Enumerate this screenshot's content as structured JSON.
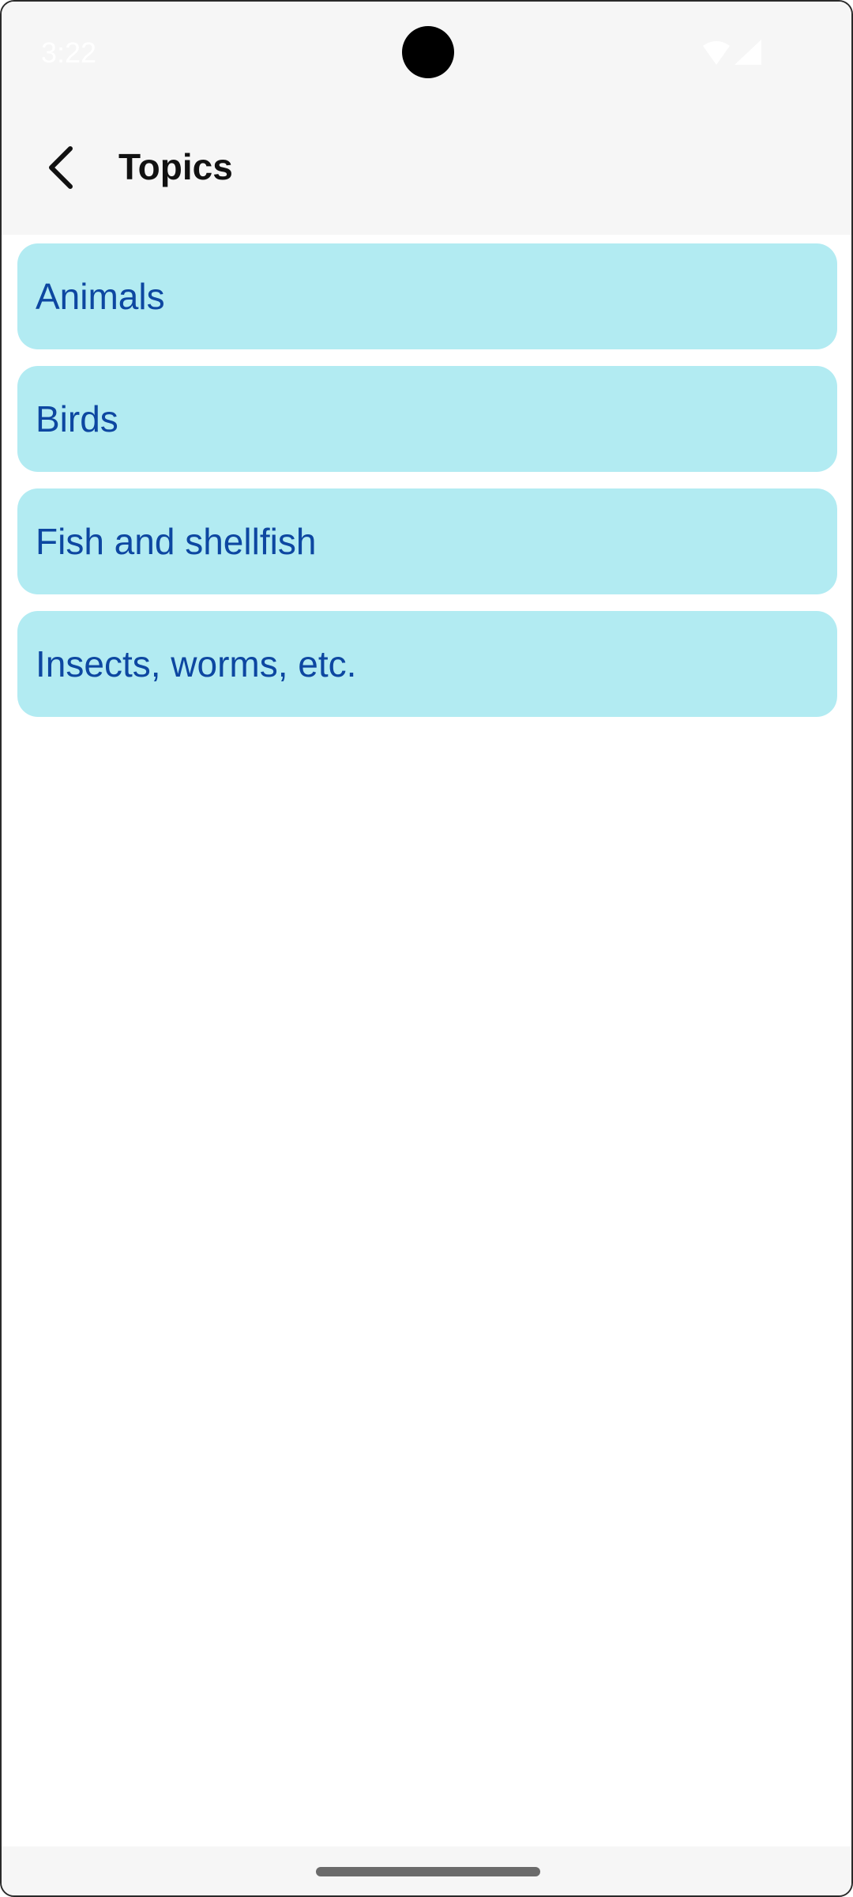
{
  "status_bar": {
    "time": "3:22",
    "icons": [
      "wifi-icon",
      "cellular-signal-icon"
    ]
  },
  "app_bar": {
    "back_icon": "chevron-left-icon",
    "title": "Topics"
  },
  "topics": [
    {
      "label": "Animals"
    },
    {
      "label": "Birds"
    },
    {
      "label": "Fish and shellfish"
    },
    {
      "label": "Insects, worms, etc."
    }
  ],
  "colors": {
    "item_background": "#b2ebf2",
    "item_text": "#0d47a1",
    "bar_background": "#f6f6f6"
  }
}
